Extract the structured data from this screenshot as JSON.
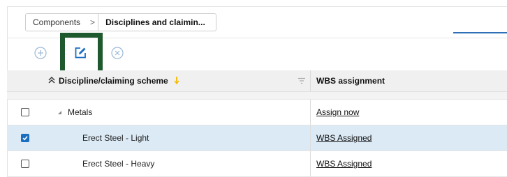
{
  "breadcrumb": {
    "items": [
      {
        "label": "Components"
      },
      {
        "label": "Disciplines and claimin..."
      }
    ],
    "separator": ">"
  },
  "toolbar": {
    "buttons": [
      {
        "name": "add",
        "icon": "plus-circle-icon"
      },
      {
        "name": "edit",
        "icon": "edit-icon"
      },
      {
        "name": "cancel",
        "icon": "close-circle-icon"
      }
    ]
  },
  "grid": {
    "columns": {
      "name": "Discipline/claiming scheme",
      "wbs": "WBS assignment"
    },
    "rows": [
      {
        "name": "Metals",
        "wbs": "Assign now",
        "checked": false,
        "level": 0,
        "expanded": true
      },
      {
        "name": "Erect Steel - Light",
        "wbs": "WBS Assigned",
        "checked": true,
        "level": 1
      },
      {
        "name": "Erect Steel - Heavy",
        "wbs": "WBS Assigned",
        "checked": false,
        "level": 1
      }
    ]
  },
  "colors": {
    "accent": "#2f6fb5",
    "highlight_border": "#1f5a2f",
    "selected_row": "#dbeaf5",
    "sort_indicator": "#f5b800"
  }
}
